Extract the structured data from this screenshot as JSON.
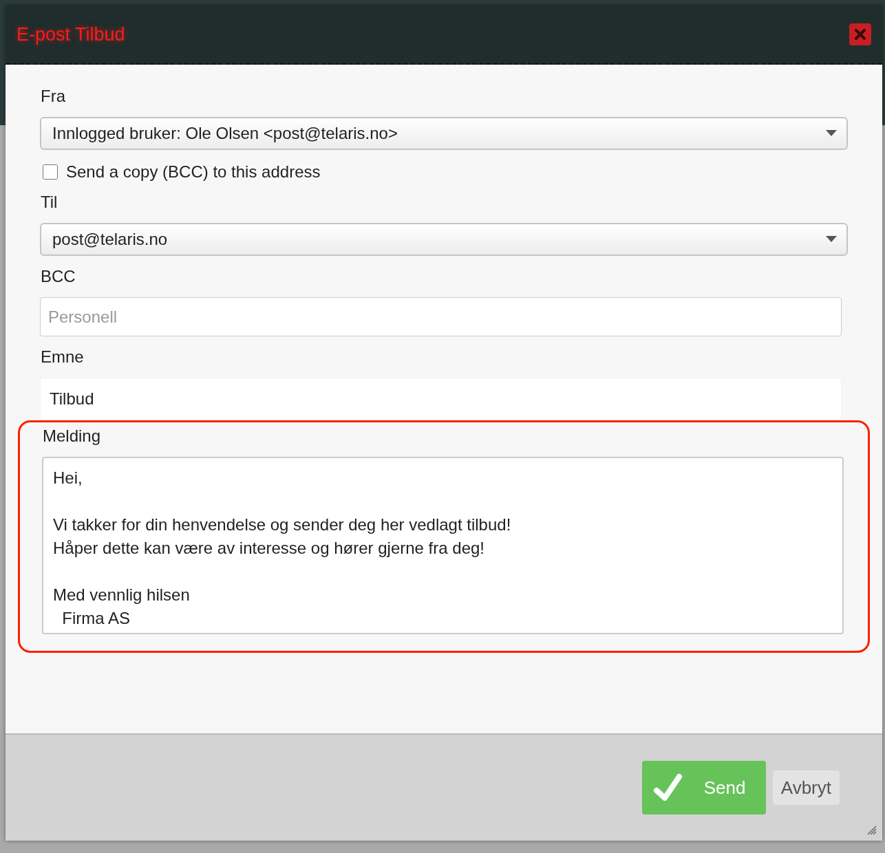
{
  "dialog": {
    "title": "E-post Tilbud"
  },
  "from": {
    "label": "Fra",
    "value": "Innlogged bruker: Ole Olsen <post@telaris.no>"
  },
  "bcc_copy": {
    "label": "Send a copy (BCC) to this address",
    "checked": false
  },
  "to": {
    "label": "Til",
    "value": "post@telaris.no"
  },
  "bcc": {
    "label": "BCC",
    "placeholder": "Personell"
  },
  "subject": {
    "label": "Emne",
    "value": "Tilbud"
  },
  "message": {
    "label": "Melding",
    "value": "Hei,\n\nVi takker for din henvendelse og sender deg her vedlagt tilbud!\nHåper dette kan være av interesse og hører gjerne fra deg!\n\nMed vennlig hilsen\n  Firma AS",
    "highlighted": true
  },
  "buttons": [
    {
      "kind": "primary",
      "label": "Send"
    },
    {
      "kind": "secondary",
      "label": "Avbryt"
    }
  ]
}
